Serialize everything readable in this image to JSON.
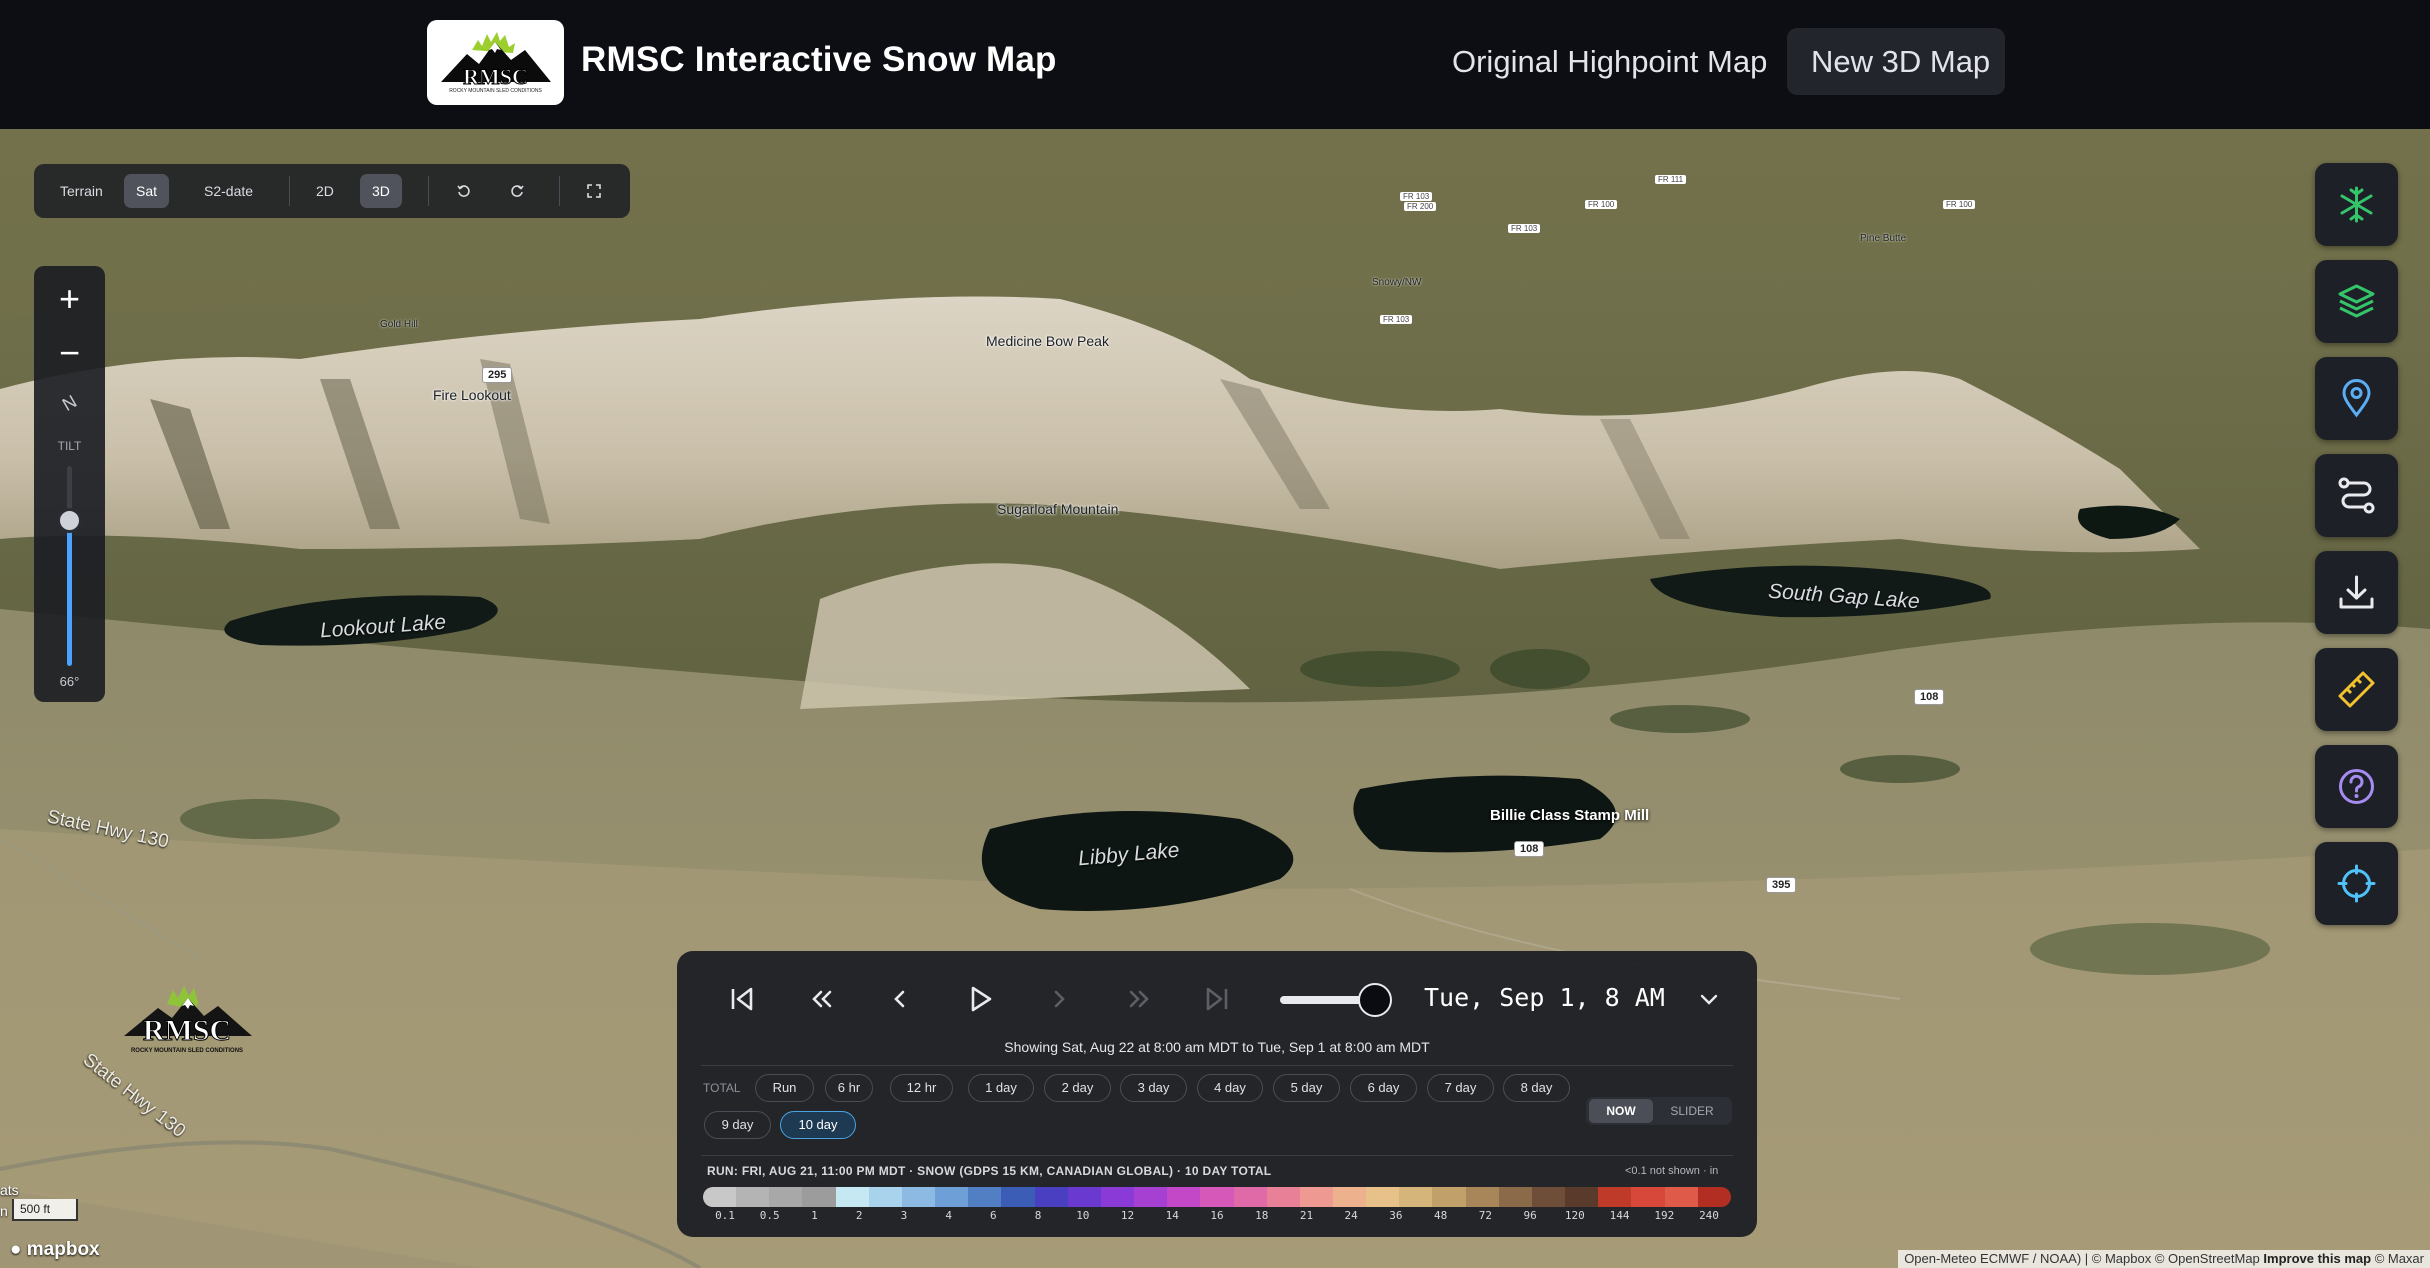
{
  "header": {
    "logo_text": "RMSC",
    "logo_subtext": "ROCKY MOUNTAIN SLED CONDITIONS",
    "title": "RMSC Interactive Snow Map",
    "nav": [
      {
        "label": "Original Highpoint Map"
      },
      {
        "label": "New 3D Map",
        "active": true
      }
    ]
  },
  "map_style_bar": {
    "buttons": [
      {
        "label": "Terrain",
        "active": false
      },
      {
        "label": "Sat",
        "active": true
      },
      {
        "label": "S2-date",
        "active": false
      },
      {
        "label": "2D",
        "active": false
      },
      {
        "label": "3D",
        "active": true
      }
    ],
    "icons": [
      "rotate-left-icon",
      "rotate-right-icon",
      "fullscreen-icon"
    ]
  },
  "zoom_panel": {
    "zoom_in": "+",
    "zoom_out": "−",
    "compass": "N",
    "tilt_label": "TILT",
    "tilt_value": "66°",
    "tilt_fraction": 0.73
  },
  "map_labels": {
    "lakes": [
      "Lookout Lake",
      "South Gap Lake",
      "Libby Lake"
    ],
    "peaks": [
      "Medicine Bow Peak",
      "Sugarloaf Mountain",
      "Fire Lookout",
      "Gold Hill",
      "Pine Butte",
      "Snowy/NW"
    ],
    "places": [
      "Billie Class Stamp Mill"
    ],
    "highways": [
      "State Hwy 130",
      "State Hwy 130"
    ],
    "road_shields": [
      "108",
      "108",
      "395",
      "295"
    ],
    "forest_roads": [
      "FR 103",
      "FR 103",
      "FR 103",
      "FR 200",
      "FR 100",
      "FR 100",
      "FR 111"
    ]
  },
  "right_tools": [
    {
      "icon": "snowflake-icon",
      "color": "#34c46a"
    },
    {
      "icon": "layers-icon",
      "color": "#34c46a"
    },
    {
      "icon": "location-pin-icon",
      "color": "#5aaef5"
    },
    {
      "icon": "route-icon",
      "color": "#e8eaee"
    },
    {
      "icon": "download-icon",
      "color": "#e8eaee"
    },
    {
      "icon": "ruler-icon",
      "color": "#f2c12e"
    },
    {
      "icon": "help-icon",
      "color": "#a68cf0"
    },
    {
      "icon": "crosshair-icon",
      "color": "#4fc3f7"
    }
  ],
  "timeline": {
    "date": "Tue, Sep 1, 8 AM",
    "slider_fraction": 1.0,
    "showing": "Showing Sat, Aug 22 at 8:00 am MDT to Tue, Sep 1 at 8:00 am MDT",
    "total_label": "TOTAL",
    "chips": [
      "Run",
      "6 hr",
      "12 hr",
      "1 day",
      "2 day",
      "3 day",
      "4 day",
      "5 day",
      "6 day",
      "7 day",
      "8 day",
      "9 day",
      "10 day"
    ],
    "active_chip": "10 day",
    "mode": {
      "now": "NOW",
      "slider": "SLIDER",
      "active": "NOW"
    },
    "run_info": "RUN: FRI, AUG 21, 11:00 PM MDT · SNOW (GDPS 15 KM, CANADIAN GLOBAL) · 10 DAY TOTAL",
    "note": "<0.1 not shown · in",
    "legend_ticks": [
      "0.1",
      "0.5",
      "1",
      "2",
      "3",
      "4",
      "6",
      "8",
      "10",
      "12",
      "14",
      "16",
      "18",
      "21",
      "24",
      "36",
      "48",
      "72",
      "96",
      "120",
      "144",
      "192",
      "240"
    ],
    "legend_colors": [
      "#c8c8c8",
      "#b4b4b4",
      "#a8a8a8",
      "#9c9c9c",
      "#c6e8f2",
      "#a9d2ec",
      "#8cbae2",
      "#6e9fd6",
      "#527fc4",
      "#3b5db6",
      "#4a3fc0",
      "#6a3ad0",
      "#8a3ad6",
      "#a640d2",
      "#c248c8",
      "#d658b8",
      "#e06aa8",
      "#e88098",
      "#ee9a92",
      "#eeb18e",
      "#e7c08a",
      "#d6b57a",
      "#c2a06a",
      "#a8865a",
      "#8a6a48",
      "#6e4e38",
      "#5a3a2a",
      "#c03a2a",
      "#d8483a",
      "#e05a4a",
      "#b22e22"
    ]
  },
  "scale": {
    "value": "500 ft"
  },
  "attribution": {
    "mapbox": "mapbox",
    "text": "Open-Meteo ECMWF / NOAA) | © Mapbox © OpenStreetMap",
    "improve": "Improve this map",
    "maxar": "© Maxar"
  }
}
